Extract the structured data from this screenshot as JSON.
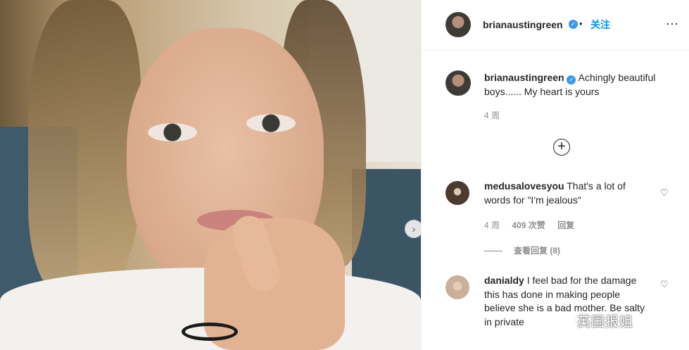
{
  "post": {
    "username": "brianaustingreen",
    "follow_label": "关注",
    "more_icon": "⋯"
  },
  "caption": {
    "username": "brianaustingreen",
    "text": "Achingly beautiful boys...... My heart is yours",
    "age": "4 周"
  },
  "comments": [
    {
      "username": "medusalovesyou",
      "text": "That's a lot of words for \"I'm jealous\"",
      "age": "4 周",
      "likes": "409 次赞",
      "reply_label": "回复"
    },
    {
      "username": "danialdy",
      "text": "I feel bad for the damage this has done in making people believe she is a bad mother. Be salty in private",
      "age": "",
      "likes": "",
      "reply_label": ""
    }
  ],
  "view_replies_label": "查看回复 (8)",
  "watermark": "英国报姐",
  "colors": {
    "link_blue": "#0095f6",
    "verified_blue": "#3897f0",
    "muted_text": "#8e8e8e"
  }
}
